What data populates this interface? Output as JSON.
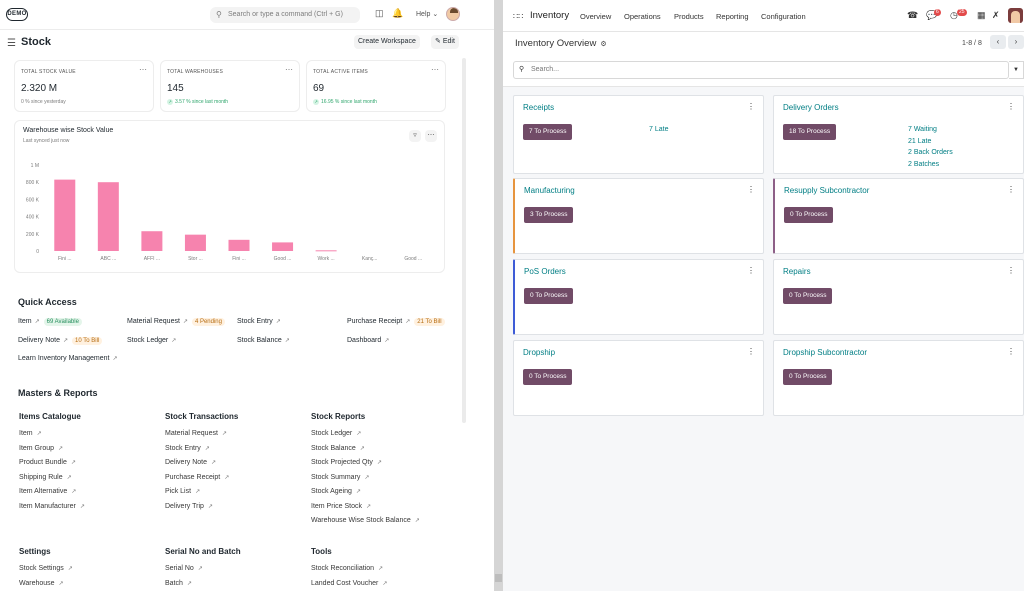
{
  "left": {
    "topbar": {
      "logo_text": "DEMO",
      "search_placeholder": "Search or type a command (Ctrl + G)",
      "help_label": "Help"
    },
    "page": {
      "title": "Stock",
      "create_workspace": "Create Workspace",
      "edit": "Edit"
    },
    "cards": [
      {
        "label": "TOTAL STOCK VALUE",
        "value": "2.320 M",
        "sub": "0 % since yesterday",
        "trend": "none"
      },
      {
        "label": "TOTAL WAREHOUSES",
        "value": "145",
        "sub": "3.57 % since last month",
        "trend": "up"
      },
      {
        "label": "TOTAL ACTIVE ITEMS",
        "value": "69",
        "sub": "16.95 % since last month",
        "trend": "up"
      }
    ],
    "chart_data": {
      "type": "bar",
      "title": "Warehouse wise Stock Value",
      "subtitle": "Last synced just now",
      "categories": [
        "Fini ...",
        "ABC ...",
        "AFFI ...",
        "Stor ...",
        "Fini ...",
        "Good ...",
        "Work ...",
        "Kanç...",
        "Good ..."
      ],
      "values": [
        830,
        800,
        230,
        190,
        130,
        100,
        8,
        0,
        0
      ],
      "ylim": [
        0,
        1000
      ],
      "yticks": [
        0,
        200,
        400,
        600,
        800,
        1000
      ],
      "ytick_labels": [
        "0",
        "200 K",
        "400 K",
        "600 K",
        "800 K",
        "1 M"
      ],
      "color": "#f683ae",
      "grid": false,
      "legend": "none"
    },
    "quick_access": {
      "title": "Quick Access",
      "items": [
        {
          "label": "Item",
          "pill": "69 Available",
          "pill_kind": "green"
        },
        {
          "label": "Material Request",
          "pill": "4 Pending",
          "pill_kind": "orange"
        },
        {
          "label": "Stock Entry",
          "pill": "",
          "pill_kind": ""
        },
        {
          "label": "Purchase Receipt",
          "pill": "21 To Bill",
          "pill_kind": "orange"
        },
        {
          "label": "Delivery Note",
          "pill": "10 To Bill",
          "pill_kind": "orange"
        },
        {
          "label": "Stock Ledger",
          "pill": "",
          "pill_kind": ""
        },
        {
          "label": "Stock Balance",
          "pill": "",
          "pill_kind": ""
        },
        {
          "label": "Dashboard",
          "pill": "",
          "pill_kind": ""
        },
        {
          "label": "Learn Inventory Management",
          "pill": "",
          "pill_kind": ""
        }
      ]
    },
    "masters": {
      "title": "Masters & Reports",
      "columns": [
        {
          "heading": "Items Catalogue",
          "links": [
            "Item",
            "Item Group",
            "Product Bundle",
            "Shipping Rule",
            "Item Alternative",
            "Item Manufacturer"
          ]
        },
        {
          "heading": "Stock Transactions",
          "links": [
            "Material Request",
            "Stock Entry",
            "Delivery Note",
            "Purchase Receipt",
            "Pick List",
            "Delivery Trip"
          ]
        },
        {
          "heading": "Stock Reports",
          "links": [
            "Stock Ledger",
            "Stock Balance",
            "Stock Projected Qty",
            "Stock Summary",
            "Stock Ageing",
            "Item Price Stock",
            "Warehouse Wise Stock Balance"
          ]
        },
        {
          "heading": "Settings",
          "links": [
            "Stock Settings",
            "Warehouse"
          ]
        },
        {
          "heading": "Serial No and Batch",
          "links": [
            "Serial No",
            "Batch"
          ]
        },
        {
          "heading": "Tools",
          "links": [
            "Stock Reconciliation",
            "Landed Cost Voucher"
          ]
        }
      ]
    }
  },
  "right": {
    "nav": {
      "app_name": "Inventory",
      "menu": [
        "Overview",
        "Operations",
        "Products",
        "Reporting",
        "Configuration"
      ],
      "chat_badge": "6",
      "activity_badge": "25"
    },
    "control": {
      "title": "Inventory Overview",
      "pager": "1-8 / 8",
      "search_placeholder": "Search..."
    },
    "cards": [
      {
        "name": "Receipts",
        "button": "7 To Process",
        "side": [
          "7 Late"
        ],
        "accent": ""
      },
      {
        "name": "Delivery Orders",
        "button": "18 To Process",
        "side": [
          "7 Waiting",
          "21 Late",
          "2 Back Orders",
          "2 Batches"
        ],
        "accent": ""
      },
      {
        "name": "Manufacturing",
        "button": "3 To Process",
        "side": [],
        "accent": "orange"
      },
      {
        "name": "Resupply Subcontractor",
        "button": "0 To Process",
        "side": [],
        "accent": "purple"
      },
      {
        "name": "PoS Orders",
        "button": "0 To Process",
        "side": [],
        "accent": "blue"
      },
      {
        "name": "Repairs",
        "button": "0 To Process",
        "side": [],
        "accent": ""
      },
      {
        "name": "Dropship",
        "button": "0 To Process",
        "side": [],
        "accent": ""
      },
      {
        "name": "Dropship Subcontractor",
        "button": "0 To Process",
        "side": [],
        "accent": ""
      }
    ]
  }
}
